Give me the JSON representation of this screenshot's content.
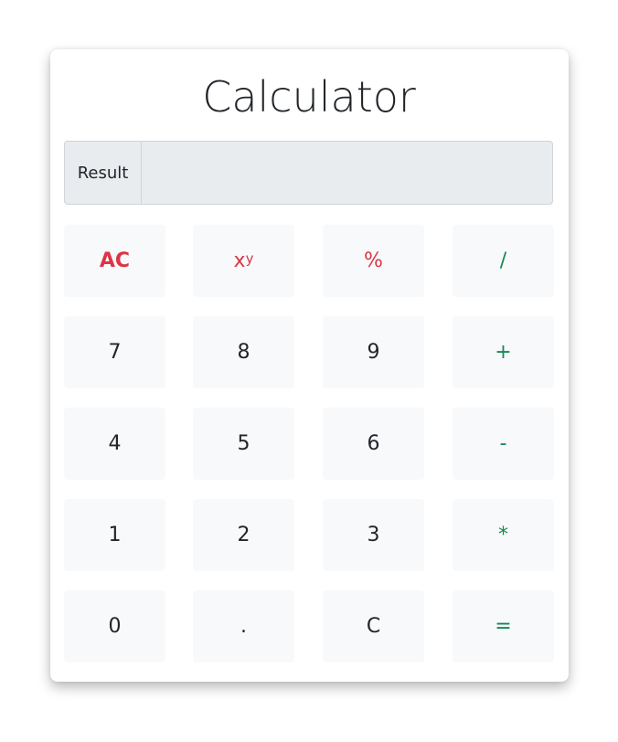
{
  "app": {
    "title": "Calculator"
  },
  "result": {
    "label": "Result",
    "value": ""
  },
  "colors": {
    "danger": "#dc3545",
    "success": "#198754",
    "key_background": "#f8f9fa",
    "display_background": "#e9ecef"
  },
  "keys": {
    "clear_all": "AC",
    "power_base": "x",
    "power_exp": "y",
    "percent": "%",
    "divide": "/",
    "seven": "7",
    "eight": "8",
    "nine": "9",
    "plus": "+",
    "four": "4",
    "five": "5",
    "six": "6",
    "minus": "-",
    "one": "1",
    "two": "2",
    "three": "3",
    "multiply": "*",
    "zero": "0",
    "decimal": ".",
    "clear": "C",
    "equals": "="
  }
}
